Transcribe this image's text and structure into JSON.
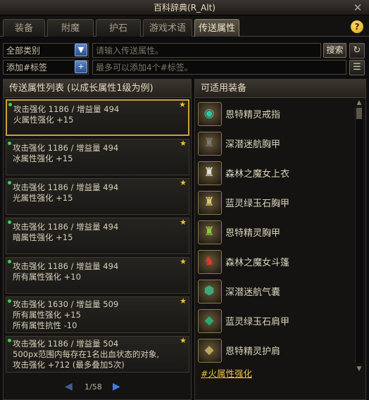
{
  "window": {
    "title": "百科辞典(R_Alt)",
    "close_icon": "✕"
  },
  "tabs": [
    {
      "label": "装备",
      "active": false
    },
    {
      "label": "附魔",
      "active": false
    },
    {
      "label": "护石",
      "active": false
    },
    {
      "label": "游戏术语",
      "active": false
    },
    {
      "label": "传送属性",
      "active": true
    }
  ],
  "help": {
    "label": "?"
  },
  "filters": {
    "category": "全部类别",
    "search_placeholder": "请输入传送属性。",
    "search_button": "搜索",
    "tag_input": "添加#标签",
    "tag_hint": "最多可以添加4个#标签。"
  },
  "left_panel": {
    "title": "传送属性列表 (以成长属性1级为例)",
    "items": [
      {
        "lines": [
          "攻击强化 1186 / 增益量 494",
          "火属性强化 +15"
        ],
        "selected": true
      },
      {
        "lines": [
          "攻击强化 1186 / 增益量 494",
          "冰属性强化 +15"
        ],
        "selected": false
      },
      {
        "lines": [
          "攻击强化 1186 / 增益量 494",
          "光属性强化 +15"
        ],
        "selected": false
      },
      {
        "lines": [
          "攻击强化 1186 / 增益量 494",
          "暗属性强化 +15"
        ],
        "selected": false
      },
      {
        "lines": [
          "攻击强化 1186 / 增益量 494",
          "所有属性强化 +10"
        ],
        "selected": false
      },
      {
        "lines": [
          "攻击强化 1630 / 增益量 509",
          "所有属性强化 +15",
          "所有属性抗性 -10"
        ],
        "selected": false
      },
      {
        "lines": [
          "攻击强化 1186 / 增益量 504",
          "500px范围内每存在1名出血状态的对象,",
          "攻击强化 +712 (最多叠加5次)"
        ],
        "selected": false
      }
    ],
    "pagination": {
      "current": "1/58"
    }
  },
  "right_panel": {
    "title": "可适用装备",
    "items": [
      {
        "name": "恩特精灵戒指",
        "icon": "ring-icon",
        "glyph": "◉",
        "color": "#2fc6a0"
      },
      {
        "name": "深潜迷航胸甲",
        "icon": "chest-armor-icon",
        "glyph": "♜",
        "color": "#7d7a72"
      },
      {
        "name": "森林之魔女上衣",
        "icon": "robe-icon",
        "glyph": "♜",
        "color": "#e6e1d6"
      },
      {
        "name": "蓝灵绿玉石胸甲",
        "icon": "chest-armor-icon",
        "glyph": "♜",
        "color": "#d8c77a"
      },
      {
        "name": "恩特精灵胸甲",
        "icon": "chest-armor-icon",
        "glyph": "♜",
        "color": "#8cc640"
      },
      {
        "name": "森林之魔女斗篷",
        "icon": "cloak-icon",
        "glyph": "♞",
        "color": "#d83a2a"
      },
      {
        "name": "深潜迷航气囊",
        "icon": "bag-icon",
        "glyph": "⬢",
        "color": "#3fa878"
      },
      {
        "name": "蓝灵绿玉石肩甲",
        "icon": "shoulder-icon",
        "glyph": "◆",
        "color": "#2ea870"
      },
      {
        "name": "恩特精灵护肩",
        "icon": "shoulder-icon",
        "glyph": "◆",
        "color": "#b8a860"
      }
    ],
    "tag_link": "#火属性强化"
  },
  "colors": {
    "accent_gold": "#c9a23a",
    "link": "#f0c040",
    "active_dot": "#3fd05a"
  }
}
